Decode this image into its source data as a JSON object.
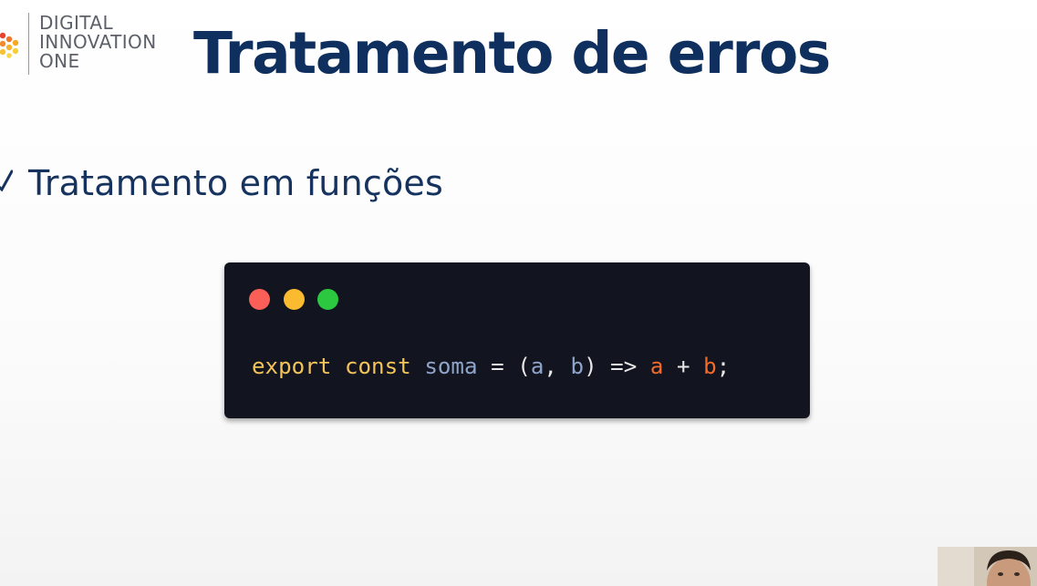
{
  "logo": {
    "line1": "DIGITAL",
    "line2": "INNOVATION",
    "line3": "ONE"
  },
  "slide": {
    "title": "Tratamento de erros",
    "bullet": "Tratamento em funções"
  },
  "code": {
    "tokens": {
      "export": "export",
      "const": "const",
      "name": "soma",
      "eq": " = ",
      "open": "(",
      "a": "a",
      "comma": ", ",
      "b": "b",
      "arrow": ") => ",
      "a2": "a",
      "plus": " + ",
      "b2": "b",
      "semi": ";"
    }
  },
  "colors": {
    "title": "#0f2f5e",
    "code_bg": "#12141f",
    "keyword": "#f2c45a",
    "identifier": "#8fa4c9",
    "variable": "#f36b2a",
    "dot_red": "#fc5f57",
    "dot_yellow": "#fbbb30",
    "dot_green": "#2bc840"
  },
  "icons": {
    "logo_mark": "dots-logo-icon",
    "bullet": "check-icon"
  }
}
